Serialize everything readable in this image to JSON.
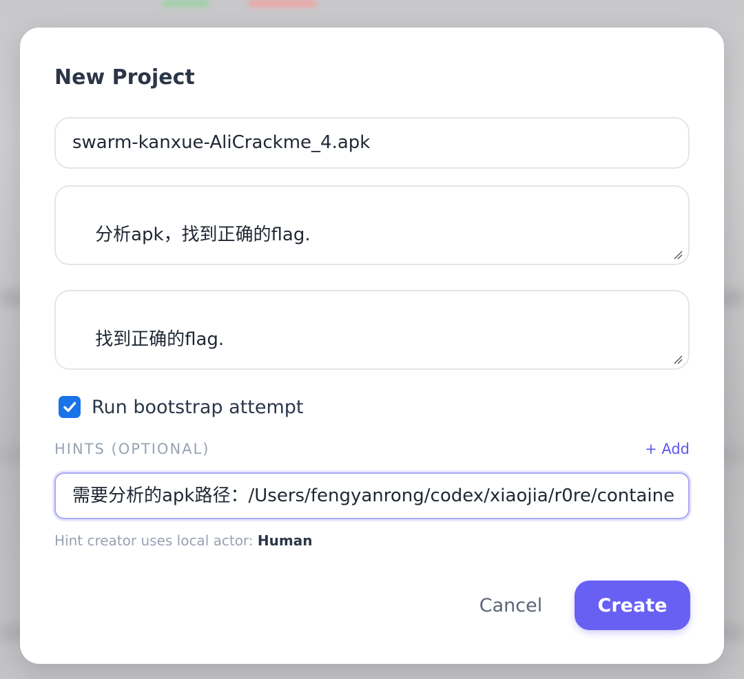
{
  "dialog": {
    "title": "New Project",
    "name_value": "swarm-kanxue-AliCrackme_4.apk",
    "description_value": "分析apk，找到正确的flag.",
    "goal_value": "找到正确的flag.",
    "bootstrap": {
      "label": "Run bootstrap attempt",
      "checked": true
    },
    "hints": {
      "label": "HINTS (OPTIONAL)",
      "add_label": "+ Add",
      "items": [
        {
          "value": "需要分析的apk路径：/Users/fengyanrong/codex/xiaojia/r0re/containe"
        }
      ],
      "note_prefix": "Hint creator uses local actor:",
      "note_actor": "Human"
    },
    "actions": {
      "cancel_label": "Cancel",
      "create_label": "Create"
    }
  },
  "colors": {
    "accent": "#6860f2",
    "checkbox": "#1a73e8",
    "text": "#2b3647",
    "muted": "#98a2b3"
  }
}
